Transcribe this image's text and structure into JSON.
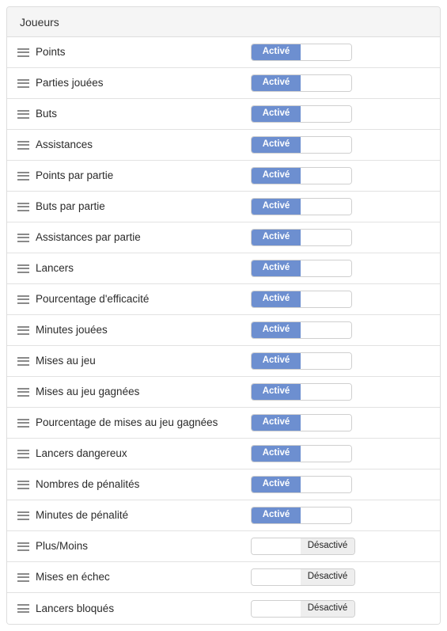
{
  "panel": {
    "title": "Joueurs",
    "toggle_on_label": "Activé",
    "toggle_off_label": "Désactivé",
    "accent_color": "#6d8fd0",
    "header_background": "#f5f5f5",
    "off_segment_color": "#eeeeee",
    "rows": [
      {
        "label": "Points",
        "state": "on",
        "state_label": "Activé"
      },
      {
        "label": "Parties jouées",
        "state": "on",
        "state_label": "Activé"
      },
      {
        "label": "Buts",
        "state": "on",
        "state_label": "Activé"
      },
      {
        "label": "Assistances",
        "state": "on",
        "state_label": "Activé"
      },
      {
        "label": "Points par partie",
        "state": "on",
        "state_label": "Activé"
      },
      {
        "label": "Buts par partie",
        "state": "on",
        "state_label": "Activé"
      },
      {
        "label": "Assistances par partie",
        "state": "on",
        "state_label": "Activé"
      },
      {
        "label": "Lancers",
        "state": "on",
        "state_label": "Activé"
      },
      {
        "label": "Pourcentage d'efficacité",
        "state": "on",
        "state_label": "Activé"
      },
      {
        "label": "Minutes jouées",
        "state": "on",
        "state_label": "Activé"
      },
      {
        "label": "Mises au jeu",
        "state": "on",
        "state_label": "Activé"
      },
      {
        "label": "Mises au jeu gagnées",
        "state": "on",
        "state_label": "Activé"
      },
      {
        "label": "Pourcentage de mises au jeu gagnées",
        "state": "on",
        "state_label": "Activé"
      },
      {
        "label": "Lancers dangereux",
        "state": "on",
        "state_label": "Activé"
      },
      {
        "label": "Nombres de pénalités",
        "state": "on",
        "state_label": "Activé"
      },
      {
        "label": "Minutes de pénalité",
        "state": "on",
        "state_label": "Activé"
      },
      {
        "label": "Plus/Moins",
        "state": "off",
        "state_label": "Désactivé"
      },
      {
        "label": "Mises en échec",
        "state": "off",
        "state_label": "Désactivé"
      },
      {
        "label": "Lancers bloqués",
        "state": "off",
        "state_label": "Désactivé"
      }
    ]
  }
}
